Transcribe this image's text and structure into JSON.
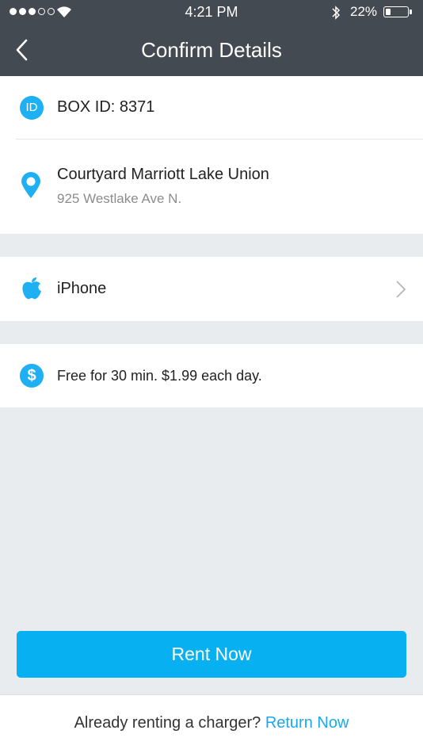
{
  "status_bar": {
    "time": "4:21 PM",
    "battery_percent": "22%",
    "battery_level": 0.22,
    "signal_bars_filled": 3,
    "signal_bars_total": 5,
    "icons": [
      "signal-dots-icon",
      "wifi-icon",
      "bluetooth-icon",
      "battery-icon"
    ]
  },
  "nav": {
    "title": "Confirm Details",
    "back_icon": "chevron-left-icon"
  },
  "box": {
    "badge": "ID",
    "label": "BOX ID: 8371"
  },
  "location": {
    "icon": "location-pin-icon",
    "name": "Courtyard Marriott Lake Union",
    "address": "925 Westlake Ave N."
  },
  "device": {
    "icon": "apple-icon",
    "label": "iPhone",
    "chevron_icon": "chevron-right-icon"
  },
  "pricing": {
    "badge": "$",
    "text": "Free for 30 min. $1.99 each day."
  },
  "actions": {
    "rent_label": "Rent Now"
  },
  "footer": {
    "prompt": "Already renting a charger?",
    "link": "Return Now"
  },
  "colors": {
    "header_bg": "#444a51",
    "accent": "#1eb0f2",
    "button": "#07b1f1",
    "link": "#1aa9ee",
    "page_bg": "#e9ecef"
  }
}
